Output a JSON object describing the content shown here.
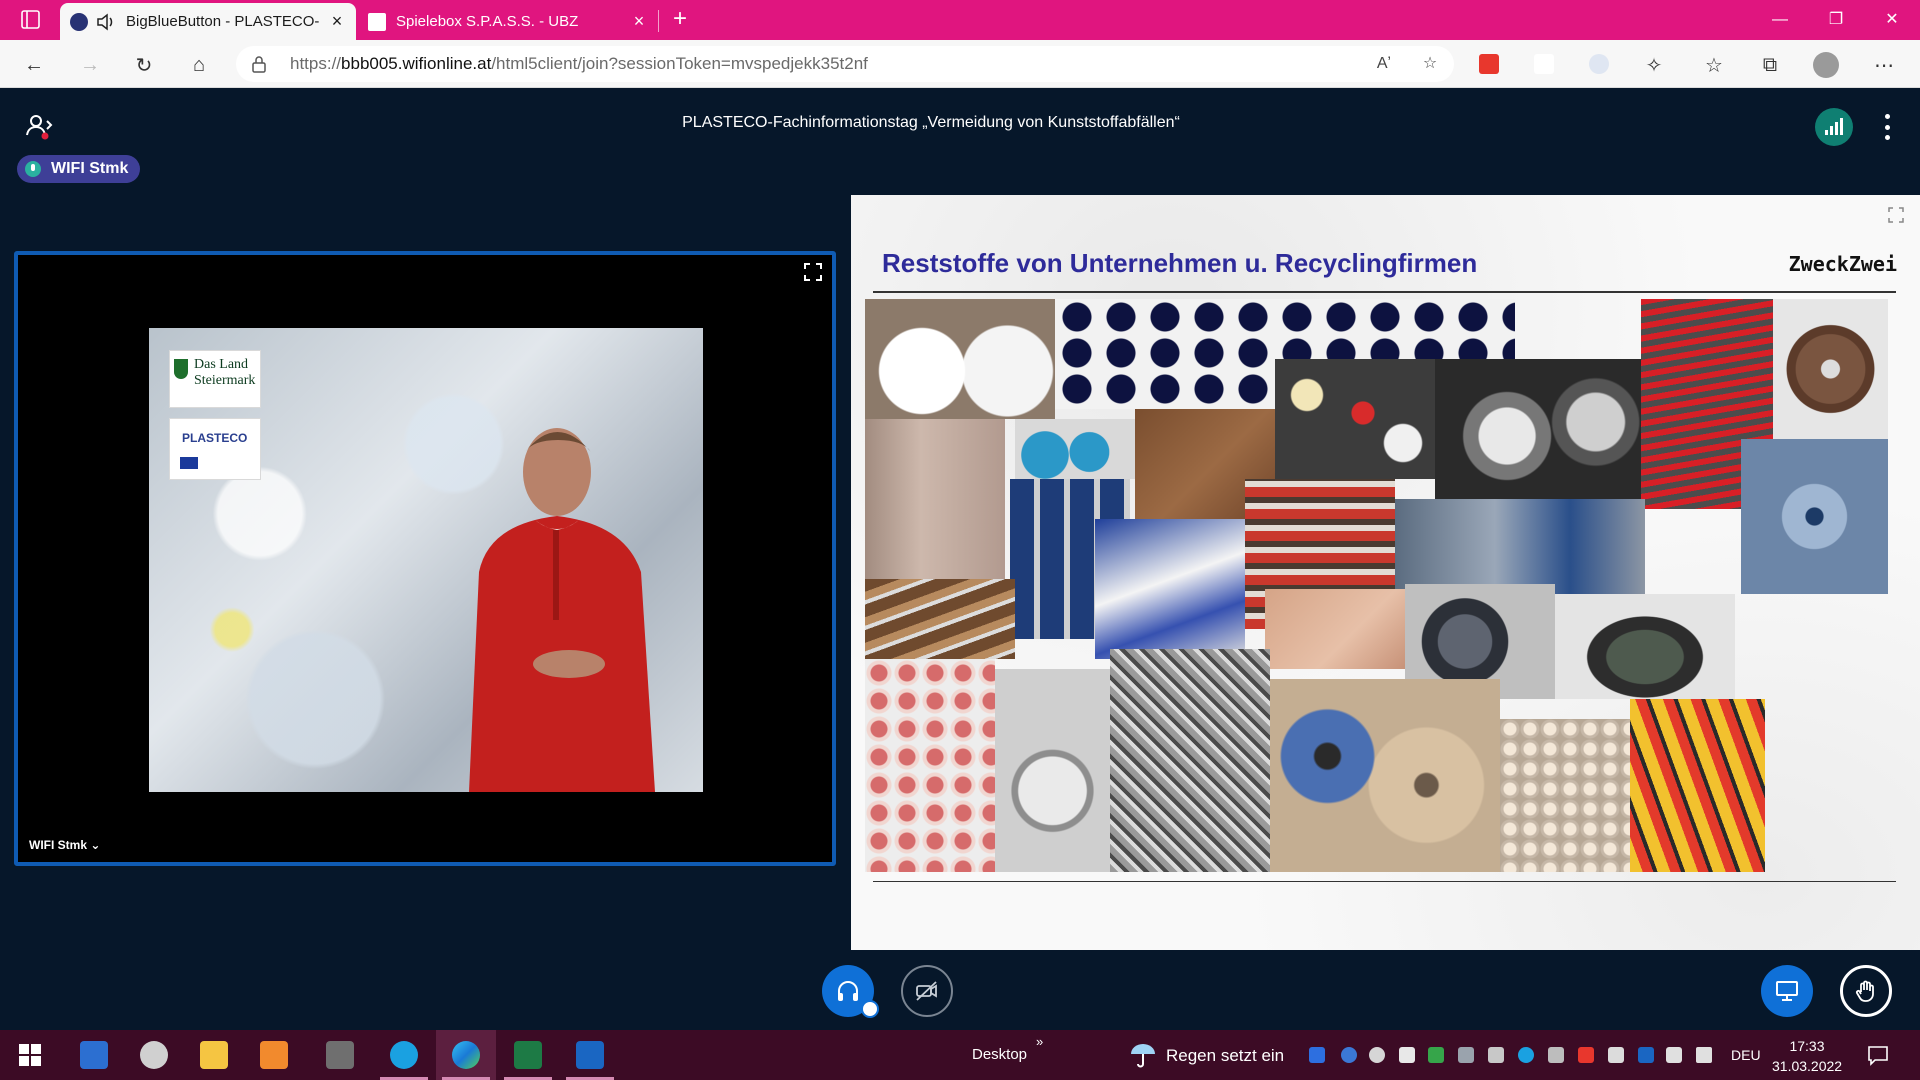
{
  "browser": {
    "tabs": [
      {
        "title": "BigBlueButton - PLASTECO-",
        "active": true
      },
      {
        "title": "Spielebox S.P.A.S.S. - UBZ",
        "active": false
      }
    ],
    "url_prefix": "https://",
    "url_host": "bbb005.wifionline.at",
    "url_path": "/html5client/join?sessionToken=mvspedjekk35t2nf",
    "accent": "#e0157f"
  },
  "meeting": {
    "title": "PLASTECO-Fachinformationstag „Vermeidung von Kunststoffabfällen“",
    "talking_indicator": "WIFI Stmk"
  },
  "webcam": {
    "user_name": "WIFI Stmk ⌄",
    "logo_land_line1": "Das Land",
    "logo_land_line2": "Steiermark",
    "logo_plasteco": "PLASTECO"
  },
  "presentation": {
    "slide_title": "Reststoffe von Unternehmen u. Recyclingfirmen",
    "slide_brand": "ZweckZwei"
  },
  "controls": {
    "audio": "headphones-icon",
    "video": "video-off-icon",
    "screenshare": "presentation-icon",
    "raise_hand": "hand-icon"
  },
  "taskbar": {
    "apps": [
      "start-icon",
      "remote-desktop-icon",
      "paint-icon",
      "file-explorer-icon",
      "media-player-icon",
      "calculator-icon",
      "skype-icon",
      "edge-icon",
      "excel-icon",
      "outlook-icon"
    ],
    "desktop_label": "Desktop",
    "weather_text": "Regen setzt ein",
    "language": "DEU",
    "time": "17:33",
    "date": "31.03.2022"
  }
}
